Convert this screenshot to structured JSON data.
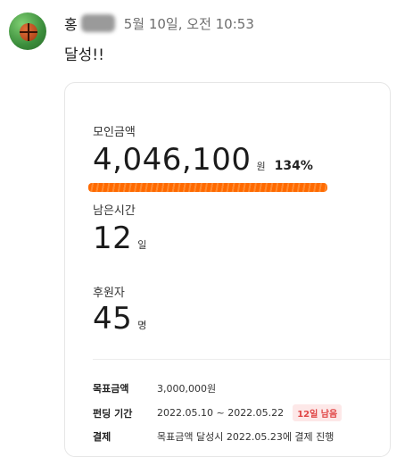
{
  "message": {
    "sender": "홍",
    "timestamp": "5월 10일, 오전 10:53",
    "text": "달성!!"
  },
  "card": {
    "amount": {
      "label": "모인금액",
      "value": "4,046,100",
      "unit": "원",
      "percent": "134%"
    },
    "time_left": {
      "label": "남은시간",
      "value": "12",
      "unit": "일"
    },
    "backers": {
      "label": "후원자",
      "value": "45",
      "unit": "명"
    },
    "info": [
      {
        "key": "목표금액",
        "value": "3,000,000원"
      },
      {
        "key": "펀딩 기간",
        "value": "2022.05.10 ~ 2022.05.22",
        "badge": "12일 남음"
      },
      {
        "key": "결제",
        "value": "목표금액 달성시 2022.05.23에 결제 진행"
      }
    ]
  },
  "colors": {
    "highlight": "#ff6a00",
    "badge_text": "#e04545",
    "badge_bg": "#fde8e8"
  }
}
